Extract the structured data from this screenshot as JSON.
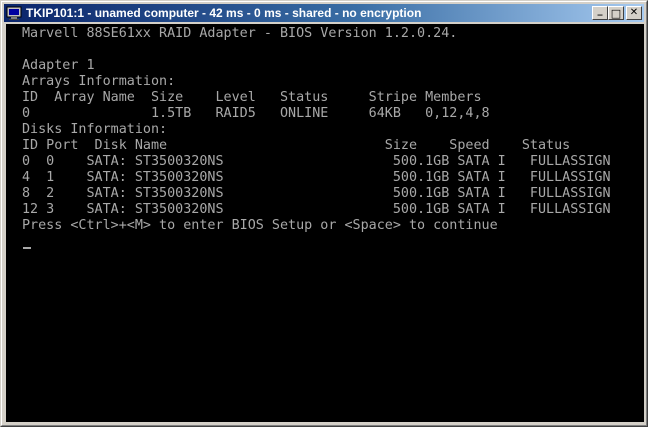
{
  "window": {
    "title": "TKIP101:1 - unamed computer - 42 ms - 0 ms - shared - no encryption",
    "minimize_glyph": "_",
    "maximize_glyph": "□",
    "close_glyph": "✕"
  },
  "bios": {
    "header": "Marvell 88SE61xx RAID Adapter - BIOS Version 1.2.0.24.",
    "adapter": "Adapter 1",
    "arrays_heading": "Arrays Information:",
    "arrays_columns": "ID  Array Name  Size    Level   Status     Stripe Members",
    "arrays_rows": [
      "0               1.5TB   RAID5   ONLINE     64KB   0,12,4,8"
    ],
    "disks_heading": "Disks Information:",
    "disks_columns": "ID Port  Disk Name                           Size    Speed    Status",
    "disks_rows": [
      "0  0    SATA: ST3500320NS                     500.1GB SATA I   FULLASSIGN",
      "4  1    SATA: ST3500320NS                     500.1GB SATA I   FULLASSIGN",
      "8  2    SATA: ST3500320NS                     500.1GB SATA I   FULLASSIGN",
      "12 3    SATA: ST3500320NS                     500.1GB SATA I   FULLASSIGN"
    ],
    "prompt": "Press <Ctrl>+<M> to enter BIOS Setup or <Space> to continue"
  },
  "colors": {
    "console_text": "#a8a8a8",
    "console_bg": "#000000",
    "titlebar_start": "#0a246a",
    "titlebar_end": "#a6caf0"
  }
}
